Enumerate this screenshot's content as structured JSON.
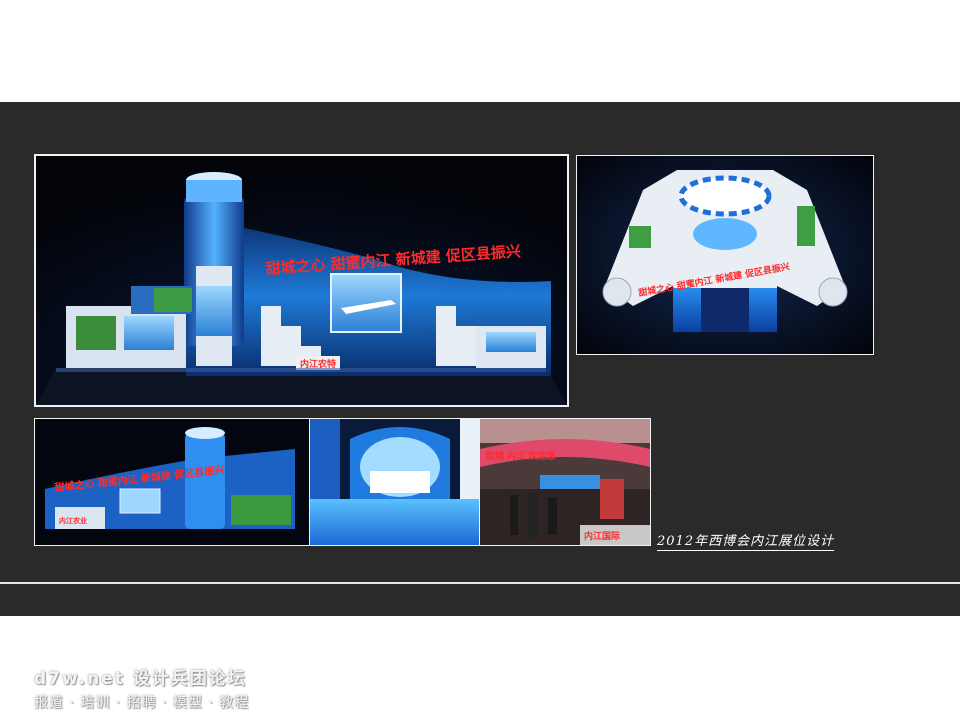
{
  "caption": "2012年西博会内江展位设计",
  "booth": {
    "slogan_main": "甜城之心 甜蜜内江 新城建 促区县振兴",
    "slogan_top": "甜城之心 甜蜜内江 新城建 促区县振兴",
    "sign_label": "内江农特",
    "side_panel_label": "内江农业",
    "photo_banner": "甜城 内江 欢迎您",
    "logo_stamp": "内江国际"
  },
  "watermark": {
    "line1": "d7w.net 设计兵团论坛",
    "line2": "报道 · 培训 · 招聘 · 模型 · 教程"
  },
  "colors": {
    "panel_bg": "#2a2a2a",
    "frame_border": "#f2f2f2",
    "accent_blue": "#1e6fd9",
    "slogan_red": "#ff2a2a"
  }
}
